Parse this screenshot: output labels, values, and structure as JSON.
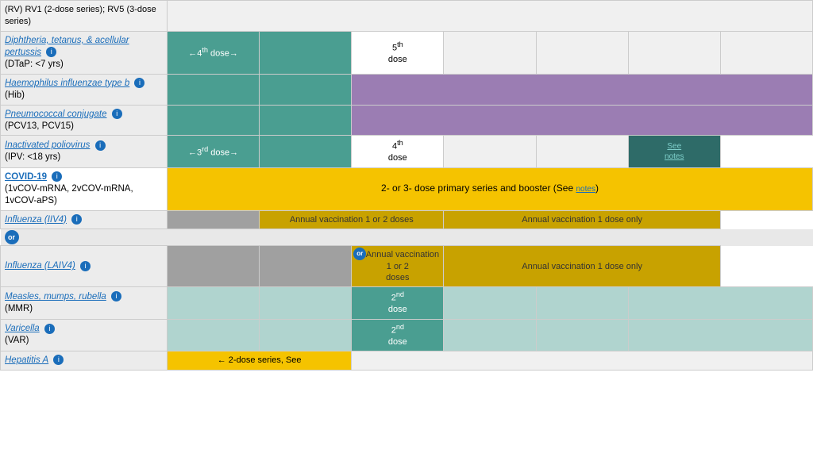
{
  "rows": [
    {
      "id": "rv",
      "name": "(RV) RV1 (2-dose series); RV5 (3-dose series)",
      "nameLink": false,
      "nameItalic": false,
      "subtitle": "",
      "infoIcon": false
    },
    {
      "id": "dtap",
      "name": "Diphtheria, tetanus, & acellular pertussis",
      "nameLink": true,
      "nameItalic": true,
      "subtitle": "(DTaP: <7 yrs)",
      "infoIcon": true,
      "dose4": "←4th dose→",
      "dose5": "5th dose"
    },
    {
      "id": "hib",
      "name": "Haemophilus influenzae type b",
      "nameLink": true,
      "nameItalic": true,
      "subtitle": "(Hib)",
      "infoIcon": true
    },
    {
      "id": "pcv",
      "name": "Pneumococcal conjugate",
      "nameLink": true,
      "nameItalic": false,
      "subtitle": "(PCV13, PCV15)",
      "infoIcon": true
    },
    {
      "id": "ipv",
      "name": "Inactivated poliovirus",
      "nameLink": true,
      "nameItalic": true,
      "subtitle": "(IPV: <18 yrs)",
      "infoIcon": true,
      "dose3": "←3rd dose→",
      "dose4": "4th dose",
      "seeNotes": "See notes"
    },
    {
      "id": "covid",
      "name": "COVID-19",
      "nameLink": true,
      "subtitle": "(1vCOV-mRNA, 2vCOV-mRNA, 1vCOV-aPS)",
      "infoIcon": true,
      "content": "2- or 3- dose primary series and booster (See notes)"
    },
    {
      "id": "influenza_iiv",
      "name": "Influenza (IIV4)",
      "nameLink": true,
      "infoIcon": true,
      "annual1": "Annual vaccination 1 or 2 doses",
      "annual2": "Annual vaccination 1 dose only"
    },
    {
      "id": "or_row",
      "isOrRow": true
    },
    {
      "id": "influenza_laiv",
      "name": "Influenza (LAIV4)",
      "nameLink": true,
      "infoIcon": true,
      "annual1": "Annual vaccination 1 or 2 doses",
      "annual2": "Annual vaccination 1 dose only"
    },
    {
      "id": "mmr",
      "name": "Measles, mumps, rubella",
      "nameLink": true,
      "subtitle": "(MMR)",
      "infoIcon": true,
      "dose2": "2nd dose"
    },
    {
      "id": "varicella",
      "name": "Varicella",
      "nameLink": true,
      "subtitle": "(VAR)",
      "infoIcon": true,
      "dose2": "2nd dose"
    },
    {
      "id": "hepa",
      "name": "Hepatitis A",
      "nameLink": true,
      "infoIcon": true,
      "content": "← 2-dose series, See"
    }
  ],
  "colors": {
    "teal": "#4a9e91",
    "darkTeal": "#2e6b68",
    "purple": "#9b7db3",
    "yellow": "#f5c300",
    "gold": "#c8a200",
    "grey": "#a0a0a0",
    "lightGrey": "#d0d0d0",
    "lightTeal": "#b0d4cf",
    "bg": "#f0f0f0"
  }
}
